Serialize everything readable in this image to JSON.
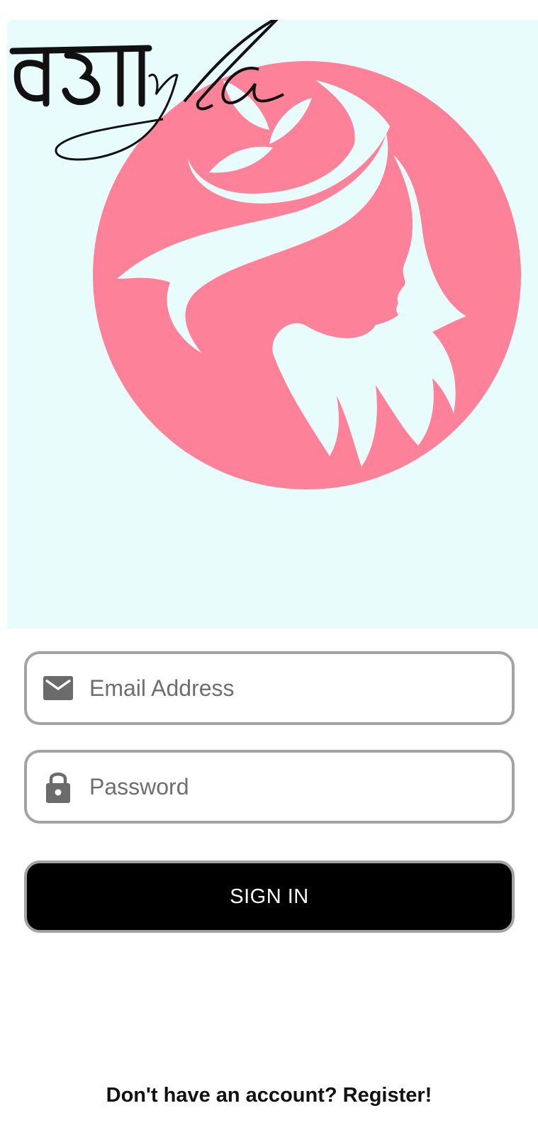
{
  "brand": {
    "logo_text": "सहाyla",
    "circle_color": "#fd8198",
    "background_color": "#e8fcfc"
  },
  "form": {
    "email": {
      "placeholder": "Email Address",
      "icon": "mail-icon"
    },
    "password": {
      "placeholder": "Password",
      "icon": "lock-icon"
    },
    "submit_label": "SIGN IN"
  },
  "footer": {
    "register_label": "Don't have an account? Register!"
  },
  "colors": {
    "button_bg": "#000000",
    "field_border": "#a3a3a3",
    "icon_gray": "#6b6b6b"
  }
}
